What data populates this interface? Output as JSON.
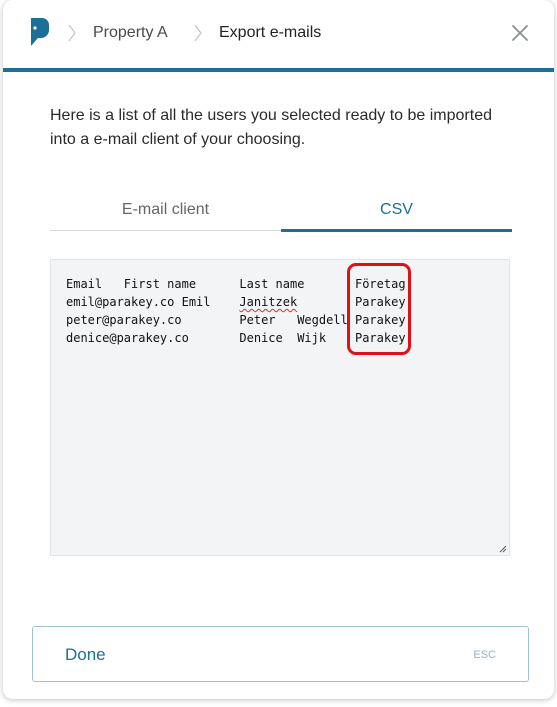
{
  "header": {
    "breadcrumbs": [
      "Property A",
      "Export e-mails"
    ]
  },
  "intro": {
    "text": "Here is a list of all the users you selected ready to be imported into a e-mail client of your choosing."
  },
  "tabs": [
    {
      "label": "E-mail client",
      "active": false
    },
    {
      "label": "CSV",
      "active": true
    }
  ],
  "csv": {
    "text_before_spell": "Email   First name      Last name       Företag\nemil@parakey.co Emil    ",
    "spell_word": "Janitzek",
    "text_after_spell": "        Parakey\npeter@parakey.co        Peter   Wegdell Parakey\ndenice@parakey.co       Denice  Wijk    Parakey"
  },
  "footer": {
    "done_label": "Done",
    "shortcut_hint": "ESC"
  },
  "colors": {
    "accent": "#1c6f96",
    "highlight": "#e0101a"
  },
  "icons": {
    "logo": "parakey-logo-icon",
    "separator": "chevron-right-icon",
    "close": "close-icon",
    "resize": "resize-grip-icon"
  }
}
